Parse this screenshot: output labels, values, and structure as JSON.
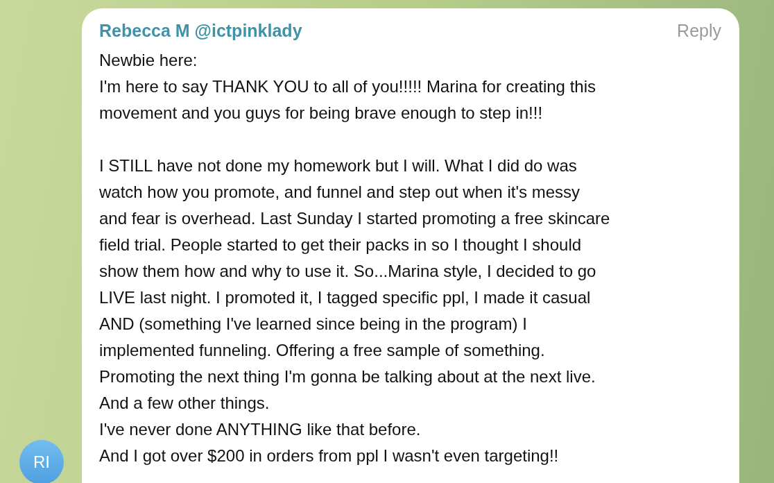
{
  "message": {
    "author": "Rebecca M @ictpinklady",
    "reply": "Reply",
    "avatar": "RI",
    "blocks": [
      {
        "lines": [
          "Newbie here:",
          "I'm here to say THANK YOU to all of you!!!!! Marina for creating this",
          "movement and you guys for being brave enough to step in!!!"
        ]
      },
      {
        "lines": [
          "I STILL have not done my homework but I will. What I did do was",
          "watch how you promote, and funnel and step out when it's messy",
          "and fear is overhead. Last Sunday I started promoting a free skincare",
          "field trial. People started to get their packs in so I thought I should",
          "show them how and why to use it. So...Marina style, I decided to go",
          "LIVE last night. I promoted it, I tagged specific ppl, I made it casual",
          "AND (something I've learned since being in the program) I",
          "implemented funneling. Offering a free sample of something.",
          "Promoting the next thing I'm gonna be talking about at the next live.",
          "And a few other things.",
          "I've never done ANYTHING like that before.",
          "And I got over $200 in orders from ppl I wasn't even targeting!!"
        ]
      }
    ]
  }
}
